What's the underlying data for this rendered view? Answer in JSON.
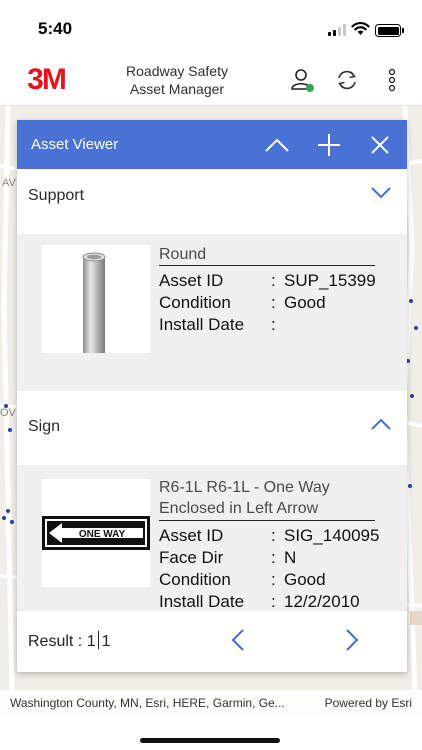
{
  "status": {
    "time": "5:40"
  },
  "header": {
    "logo_text": "3M",
    "title_line1": "Roadway Safety",
    "title_line2": "Asset Manager",
    "icons": [
      "user-online-icon",
      "sync-icon",
      "more-vertical-icon"
    ]
  },
  "map": {
    "attribution": "Washington County, MN, Esri, HERE, Garmin, Ge...",
    "powered_by": "Powered by Esri",
    "edge_labels": [
      "AV",
      "OV"
    ]
  },
  "asset_viewer": {
    "title": "Asset Viewer",
    "buttons": [
      "chevron-up-icon",
      "plus-icon",
      "close-icon"
    ],
    "groups": [
      {
        "label": "Support",
        "expanded": false,
        "item": {
          "title": "Round",
          "image": "round-post-image",
          "fields": [
            {
              "key": "Asset ID",
              "value": "SUP_15399"
            },
            {
              "key": "Condition",
              "value": "Good"
            },
            {
              "key": "Install Date",
              "value": ""
            }
          ]
        }
      },
      {
        "label": "Sign",
        "expanded": true,
        "item": {
          "title_line1": "R6-1L R6-1L - One Way",
          "title_line2": "Enclosed in Left Arrow",
          "image": "one-way-sign-image",
          "sign_text": "ONE WAY",
          "fields": [
            {
              "key": "Asset ID",
              "value": "SIG_140095"
            },
            {
              "key": "Face Dir",
              "value": "N"
            },
            {
              "key": "Condition",
              "value": "Good"
            },
            {
              "key": "Install Date",
              "value": "12/2/2010"
            }
          ]
        }
      }
    ],
    "footer": {
      "result_label": "Result :",
      "current": "1",
      "total": "1"
    }
  },
  "colors": {
    "panel_header": "#4a72d4",
    "accent_blue": "#3f6fd0",
    "logo_red": "#e3141b",
    "card_bg": "#f0f0f0"
  }
}
